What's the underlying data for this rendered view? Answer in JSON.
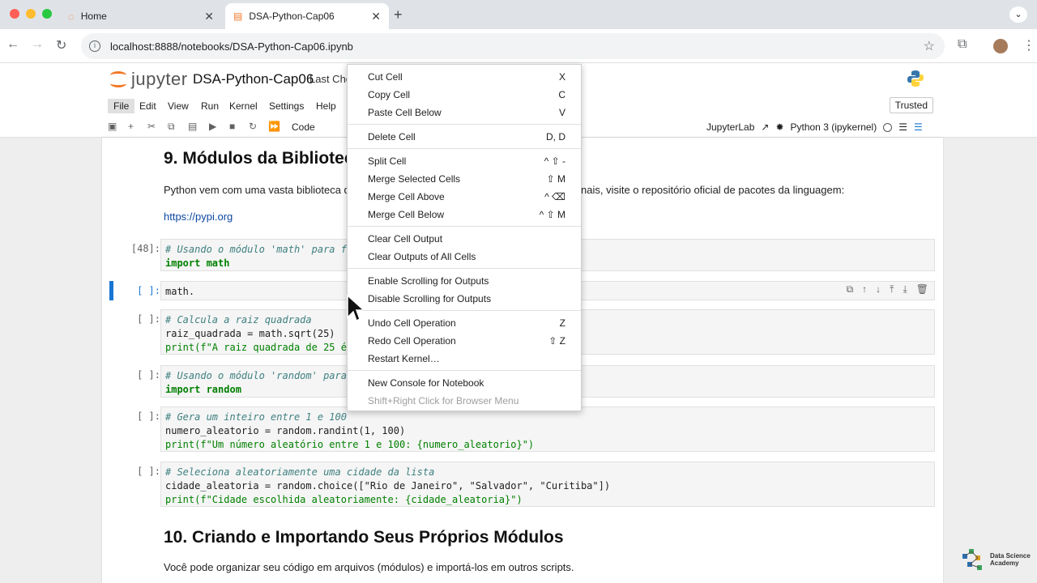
{
  "browser": {
    "tabs": [
      {
        "title": "Home"
      },
      {
        "title": "DSA-Python-Cap06"
      }
    ],
    "url": "localhost:8888/notebooks/DSA-Python-Cap06.ipynb"
  },
  "jupyter": {
    "logo_text": "jupyter",
    "notebook_title": "DSA-Python-Cap06",
    "checkpoint": "Last Che",
    "menus": [
      "File",
      "Edit",
      "View",
      "Run",
      "Kernel",
      "Settings",
      "Help"
    ],
    "trusted": "Trusted",
    "cell_type": "Code",
    "jupyterlab_link": "JupyterLab",
    "kernel": "Python 3 (ipykernel)"
  },
  "notebook": {
    "heading9": "9. Módulos da Biblioteca",
    "para1_left": "Python vem com uma vasta biblioteca de",
    "para1_right": "nais, visite o repositório oficial de pacotes da linguagem:",
    "link": "https://pypi.org",
    "cells": [
      {
        "prompt": "[48]:",
        "lines": [
          "# Usando o módulo 'math' para fung",
          "import math"
        ]
      },
      {
        "prompt": "[ ]:",
        "lines": [
          "math."
        ]
      },
      {
        "prompt": "[ ]:",
        "lines": [
          "# Calcula a raiz quadrada",
          "raiz_quadrada = math.sqrt(25)",
          "print(f\"A raiz quadrada de 25 é: {"
        ]
      },
      {
        "prompt": "[ ]:",
        "lines": [
          "# Usando o módulo 'random' para ge",
          "import random"
        ]
      },
      {
        "prompt": "[ ]:",
        "lines": [
          "# Gera um inteiro entre 1 e 100",
          "numero_aleatorio = random.randint(1, 100)",
          "print(f\"Um número aleatório entre 1 e 100: {numero_aleatorio}\")"
        ]
      },
      {
        "prompt": "[ ]:",
        "lines": [
          "# Seleciona aleatoriamente uma cidade da lista",
          "cidade_aleatoria = random.choice([\"Rio de Janeiro\", \"Salvador\", \"Curitiba\"])",
          "print(f\"Cidade escolhida aleatoriamente: {cidade_aleatoria}\")"
        ]
      }
    ],
    "heading10": "10. Criando e Importando Seus Próprios Módulos",
    "para2": "Você pode organizar seu código em arquivos (módulos) e importá-los em outros scripts."
  },
  "context_menu": {
    "groups": [
      [
        {
          "label": "Cut Cell",
          "shortcut": "X"
        },
        {
          "label": "Copy Cell",
          "shortcut": "C"
        },
        {
          "label": "Paste Cell Below",
          "shortcut": "V"
        }
      ],
      [
        {
          "label": "Delete Cell",
          "shortcut": "D, D"
        }
      ],
      [
        {
          "label": "Split Cell",
          "shortcut": "^ ⇧ -"
        },
        {
          "label": "Merge Selected Cells",
          "shortcut": "⇧ M"
        },
        {
          "label": "Merge Cell Above",
          "shortcut": "^ ⌫"
        },
        {
          "label": "Merge Cell Below",
          "shortcut": "^ ⇧ M"
        }
      ],
      [
        {
          "label": "Clear Cell Output",
          "shortcut": ""
        },
        {
          "label": "Clear Outputs of All Cells",
          "shortcut": ""
        }
      ],
      [
        {
          "label": "Enable Scrolling for Outputs",
          "shortcut": ""
        },
        {
          "label": "Disable Scrolling for Outputs",
          "shortcut": ""
        }
      ],
      [
        {
          "label": "Undo Cell Operation",
          "shortcut": "Z"
        },
        {
          "label": "Redo Cell Operation",
          "shortcut": "⇧ Z"
        },
        {
          "label": "Restart Kernel…",
          "shortcut": ""
        }
      ],
      [
        {
          "label": "New Console for Notebook",
          "shortcut": ""
        },
        {
          "label": "Shift+Right Click for Browser Menu",
          "shortcut": "",
          "disabled": true
        }
      ]
    ]
  },
  "watermark": {
    "line1": "Data Science",
    "line2": "Academy"
  },
  "colors": {
    "accent": "#1976d2",
    "jupyter_orange": "#f37726"
  }
}
